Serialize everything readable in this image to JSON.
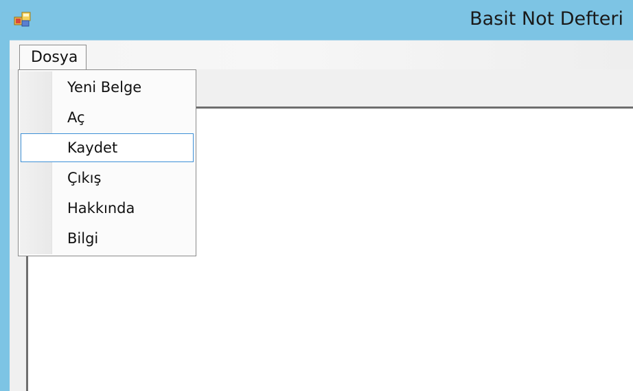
{
  "window": {
    "title": "Basit Not Defteri",
    "icon": "app-window-icon"
  },
  "menubar": {
    "items": [
      {
        "label": "Dosya",
        "open": true
      }
    ]
  },
  "dropdown": {
    "items": [
      {
        "label": "Yeni Belge",
        "highlighted": false
      },
      {
        "label": "Aç",
        "highlighted": false
      },
      {
        "label": "Kaydet",
        "highlighted": true
      },
      {
        "label": "Çıkış",
        "highlighted": false
      },
      {
        "label": "Hakkında",
        "highlighted": false
      },
      {
        "label": "Bilgi",
        "highlighted": false
      }
    ]
  },
  "editor": {
    "content": ""
  },
  "colors": {
    "titlebar": "#7dc4e4",
    "highlight_border": "#3c8fd6",
    "editor_background": "#ffffff"
  }
}
